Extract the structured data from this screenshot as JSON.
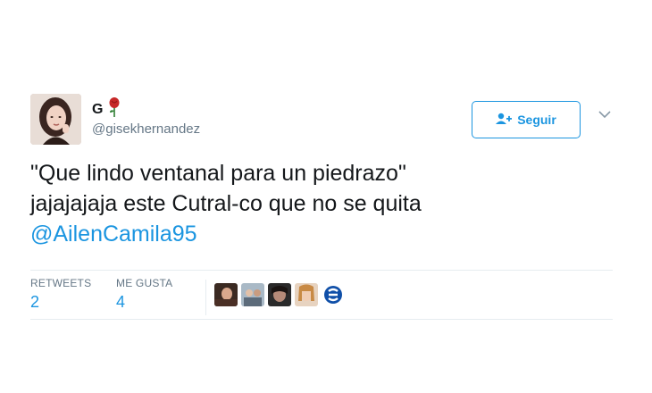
{
  "user": {
    "name": "G",
    "handle": "@gisekhernandez",
    "emoji_icon": "rose-icon"
  },
  "follow_button": {
    "label": "Seguir",
    "icon": "add-person-icon",
    "color": "#1b95e0"
  },
  "tweet": {
    "line1": "\"Que lindo ventanal para un piedrazo\"",
    "line2": "jajajajaja este Cutral-co que no se quita",
    "mention": "@AilenCamila95"
  },
  "stats": {
    "retweets_label": "RETWEETS",
    "retweets_value": "2",
    "likes_label": "ME GUSTA",
    "likes_value": "4"
  },
  "likers_count": 5
}
